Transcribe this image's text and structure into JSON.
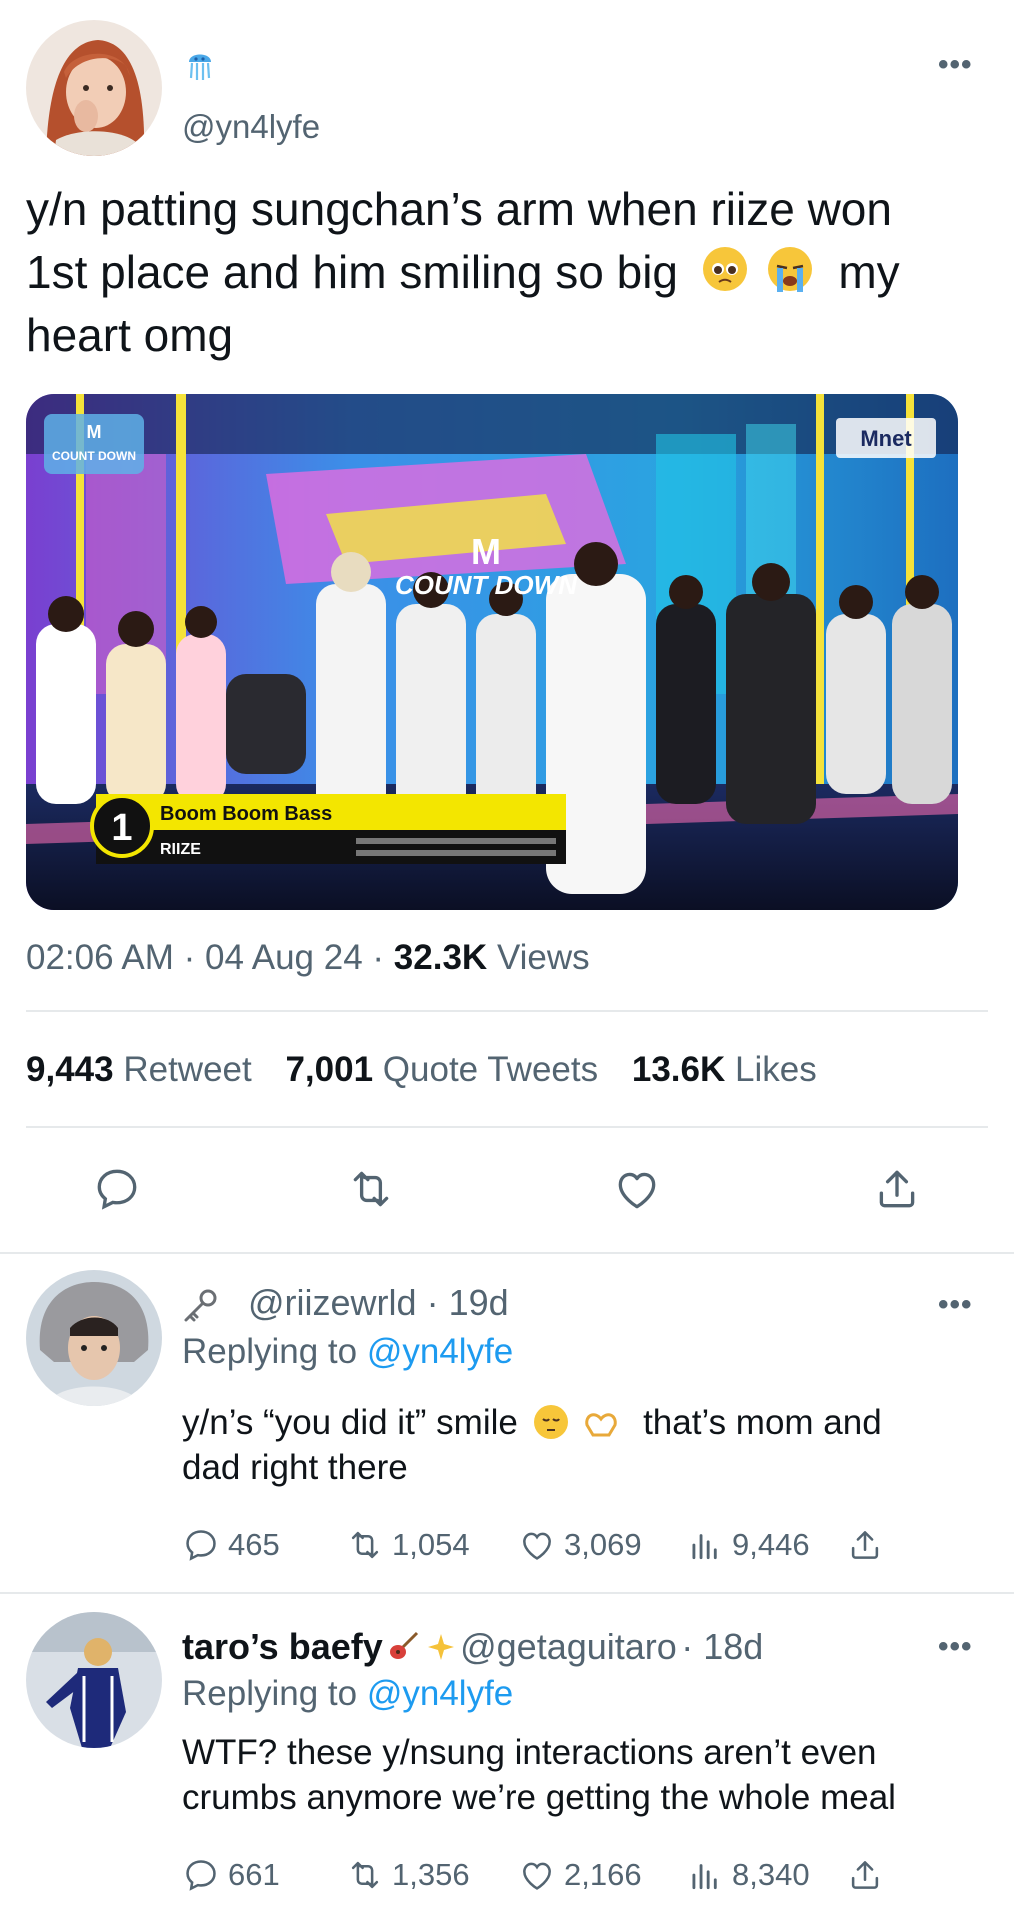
{
  "main_tweet": {
    "handle": "@yn4lyfe",
    "more_label": "•••",
    "text_line1": "y/n patting sungchan’s arm when riize won",
    "text_line2a": "1st place and him smiling so big",
    "text_line2b": "my",
    "text_line3": "heart omg",
    "media": {
      "corner_logo": "COUNT DOWN",
      "network_logo": "Mnet",
      "stage_logo": "COUNT DOWN",
      "rank": "1",
      "song_title": "Boom Boom Bass",
      "artist": "RIIZE"
    },
    "time": "02:06 AM",
    "date": "04 Aug 24",
    "sep": "·",
    "views_count": "32.3K",
    "views_label": "Views",
    "retweets_count": "9,443",
    "retweets_label": "Retweet",
    "quotes_count": "7,001",
    "quotes_label": "Quote Tweets",
    "likes_count": "13.6K",
    "likes_label": "Likes",
    "icons": [
      "reply-icon",
      "retweet-icon",
      "like-icon",
      "share-icon"
    ]
  },
  "replies": [
    {
      "prefix_icon": "key-icon",
      "handle": "@riizewrld",
      "age": "· 19d",
      "replying_label": "Replying to",
      "replying_to": "@yn4lyfe",
      "text_a": "y/n’s “you did it” smile",
      "text_b": "that’s mom and",
      "text_c": "dad right there",
      "replies": "465",
      "retweets": "1,054",
      "likes": "3,069",
      "views": "9,446",
      "more_label": "•••"
    },
    {
      "name": "taro’s baefy",
      "handle": "@getaguitaro",
      "age": "· 18d",
      "replying_label": "Replying to",
      "replying_to": "@yn4lyfe",
      "text_a": "WTF? these y/nsung interactions aren’t even",
      "text_b": "crumbs anymore we’re getting the whole meal",
      "replies": "661",
      "retweets": "1,356",
      "likes": "2,166",
      "views": "8,340",
      "more_label": "•••"
    }
  ],
  "colors": {
    "link": "#1d9bf0",
    "secondary": "#536471",
    "text": "#0f1419",
    "divider": "#e6e9eb",
    "caption_yellow": "#f3e600"
  }
}
